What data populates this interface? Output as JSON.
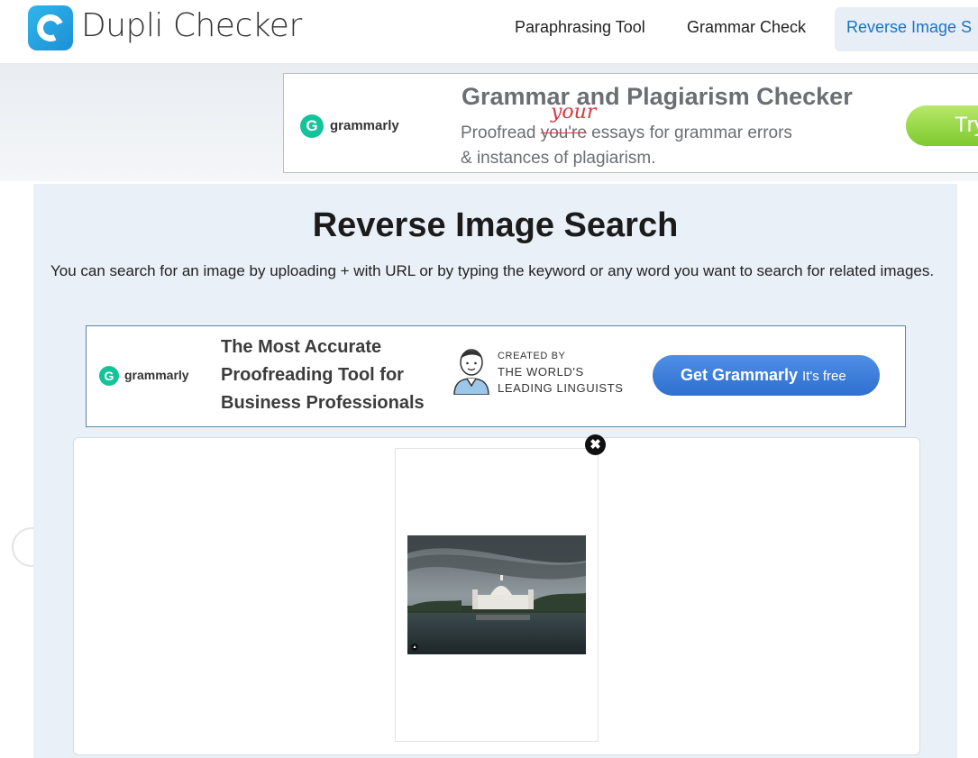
{
  "header": {
    "logo_text": "Dupli Checker",
    "logo_icon": "duplichecker-logo-icon",
    "nav": [
      {
        "label": "Paraphrasing Tool"
      },
      {
        "label": "Grammar Check"
      },
      {
        "label": "Reverse Image S",
        "active": true
      }
    ]
  },
  "ad_top": {
    "brand": "grammarly",
    "headline": "Grammar and Plagiarism Checker",
    "line1_prefix": "Proofread ",
    "line1_struck": "you're",
    "line1_correction": "your",
    "line1_suffix": " essays for grammar errors",
    "line2": "& instances of plagiarism.",
    "cta": "Try"
  },
  "main": {
    "title": "Reverse Image Search",
    "description": "You can search for an image by uploading + with URL or by typing the keyword or any word you want to search for related images."
  },
  "ad_mid": {
    "brand": "grammarly",
    "copy_lines": [
      "The Most Accurate",
      "Proofreading Tool for",
      "Business Professionals"
    ],
    "created_lines": [
      "CREATED BY",
      "THE WORLD'S",
      "LEADING LINGUISTS"
    ],
    "cta_main": "Get Grammarly",
    "cta_sub": "It's free"
  },
  "upload": {
    "close_icon": "close-icon"
  },
  "colors": {
    "accent": "#1a73c9",
    "grammarly_green": "#15c39a",
    "panel_bg": "#e9f0f8"
  }
}
